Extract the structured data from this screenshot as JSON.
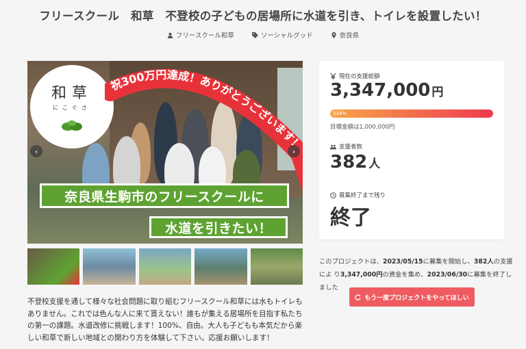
{
  "project": {
    "title": "フリースクール　和草　不登校の子どもの居場所に水道を引き、トイレを設置したい！",
    "owner": "フリースクール和草",
    "category": "ソーシャルグッド",
    "location": "奈良県"
  },
  "hero": {
    "logo_main": "和草",
    "logo_sub": "にこぐさ",
    "celebration": "祝300万円達成！ありがとうございます！",
    "banner_line1": "奈良県生駒市のフリースクールに",
    "banner_line2": "水道を引きたい！",
    "prev_icon": "chevron-left-icon",
    "next_icon": "chevron-right-icon"
  },
  "description": "不登校支援を通して様々な社会問題に取り組むフリースクール和草には水もトイレもありません。これでは色んな人に来て貰えない！誰もが集える居場所を目指す私たちの第一の課題。水道改修に挑戦します！100%、自由。大人も子どもも本気だから楽しい和草で新しい地域との関わり方を体験して下さい。応援お願いします！",
  "stats": {
    "total_label": "現在の支援総額",
    "total_amount": "3,347,000",
    "total_unit": "円",
    "progress_label": "334%",
    "progress_ratio": 1.0,
    "goal_text": "目標金額は1,000,000円",
    "supporters_label": "支援者数",
    "supporters_count": "382",
    "supporters_unit": "人",
    "remaining_label": "募集終了まで残り",
    "remaining_value": "終了"
  },
  "summary": {
    "p1": "このプロジェクトは、",
    "start": "2023/05/15",
    "p2": "に募集を開始し、",
    "count": "382人",
    "p3": "の支援によ り",
    "amount": "3,347,000円",
    "p4": "の資金を集め、",
    "end": "2023/06/30",
    "p5": "に募集を終了しました"
  },
  "cta": {
    "label": "もう一度プロジェクトをやってほしい"
  },
  "colors": {
    "accent": "#ee5b60",
    "banner_green": "#5ea332",
    "ribbon_red": "#e8323a"
  }
}
